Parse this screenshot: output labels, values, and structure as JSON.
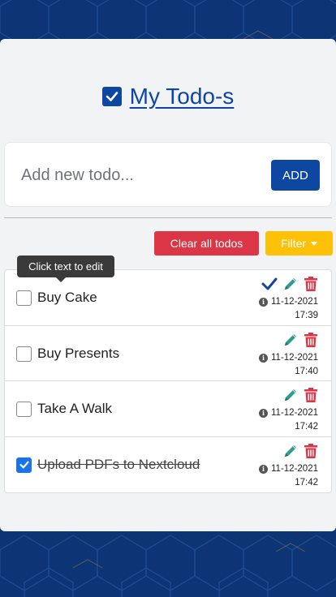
{
  "app": {
    "title": "My Todo-s",
    "title_checked": true
  },
  "new_todo": {
    "value": "",
    "placeholder": "Add new todo...",
    "add_label": "ADD"
  },
  "toolbar": {
    "clear_label": "Clear all todos",
    "filter_label": "Filter"
  },
  "tooltip": {
    "text": "Click text to edit"
  },
  "todos": [
    {
      "text": "Buy Cake",
      "done": false,
      "date": "11-12-2021",
      "time": "17:39",
      "show_complete": true
    },
    {
      "text": "Buy Presents",
      "done": false,
      "date": "11-12-2021",
      "time": "17:40",
      "show_complete": false
    },
    {
      "text": "Take A Walk",
      "done": false,
      "date": "11-12-2021",
      "time": "17:42",
      "show_complete": false
    },
    {
      "text": "Upload PDFs to Nextcloud",
      "done": true,
      "date": "11-12-2021",
      "time": "17:42",
      "show_complete": false
    }
  ],
  "colors": {
    "primary": "#0d47a1",
    "danger": "#dc3545",
    "warning": "#ffc107",
    "edit": "#2a9d8f",
    "checkbox_checked": "#1a73e8",
    "background": "#0d3474"
  },
  "icons": {
    "complete": "check-icon",
    "edit": "pencil-icon",
    "delete": "trash-icon",
    "info": "info-circle-icon"
  }
}
